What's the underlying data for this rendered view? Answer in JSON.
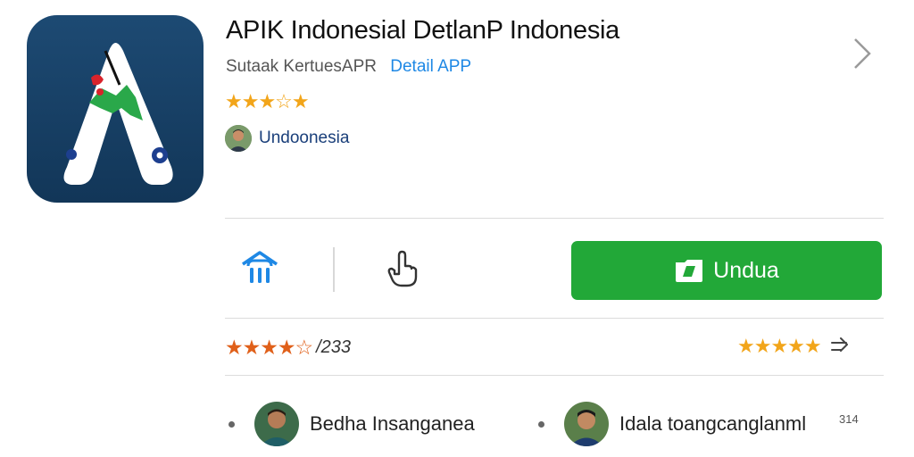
{
  "app": {
    "title": "APIK Indonesial DetlanP Indonesia",
    "developer": "Sutaak KertuesAPR",
    "detail_link": "Detail APP",
    "publisher": "Undoonesia",
    "icon_name": "app-logo-icon",
    "top_rating_stars": "★★★☆★"
  },
  "actions": {
    "home_icon": "home-icon",
    "hand_icon": "hand-pointer-icon",
    "download_label": "Undua",
    "download_icon": "folder-icon"
  },
  "ratings": {
    "left_stars": "★★★★☆",
    "left_count": "/233",
    "right_stars": "★★★★★"
  },
  "reviewers": [
    {
      "name": "Bedha Insanganea"
    },
    {
      "name": "Idala toangcanglanml"
    }
  ],
  "misc": {
    "small_count": "314"
  },
  "colors": {
    "accent_blue": "#1e88e5",
    "download_green": "#22a838",
    "star_gold": "#f2a51a",
    "star_orange": "#e0601a",
    "icon_bg": "#1d4a73"
  }
}
